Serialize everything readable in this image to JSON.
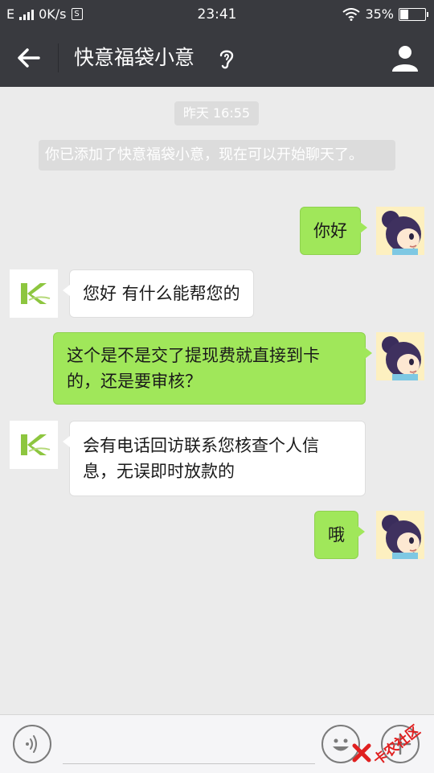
{
  "status_bar": {
    "network_type": "E",
    "speed": "0K/s",
    "sim_badge": "S",
    "time": "23:41",
    "battery_percent": "35%",
    "battery_level": 0.35
  },
  "header": {
    "title": "快意福袋小意"
  },
  "chat": {
    "timestamp": "昨天 16:55",
    "system_message": "你已添加了快意福袋小意，现在可以开始聊天了。",
    "messages": [
      {
        "sender": "me",
        "text": "你好"
      },
      {
        "sender": "other",
        "text": "您好 有什么能帮您的"
      },
      {
        "sender": "me",
        "text": "这个是不是交了提现费就直接到卡的，还是要审核？"
      },
      {
        "sender": "other",
        "text": "会有电话回访联系您核查个人信息，无误即时放款的"
      },
      {
        "sender": "me",
        "text": "哦"
      }
    ]
  },
  "input_bar": {
    "placeholder": ""
  },
  "watermark": {
    "text": "卡农社区"
  },
  "colors": {
    "header_bg": "#393a3f",
    "chat_bg": "#ebebeb",
    "my_bubble": "#a0e75a",
    "other_bubble": "#ffffff",
    "brand_green": "#8dc63f",
    "watermark_red": "#e02020"
  },
  "icons": {
    "back": "arrow-left-icon",
    "listen": "ear-icon",
    "profile": "person-icon",
    "voice": "voice-icon",
    "emoji": "smiley-icon",
    "more": "plus-icon"
  }
}
